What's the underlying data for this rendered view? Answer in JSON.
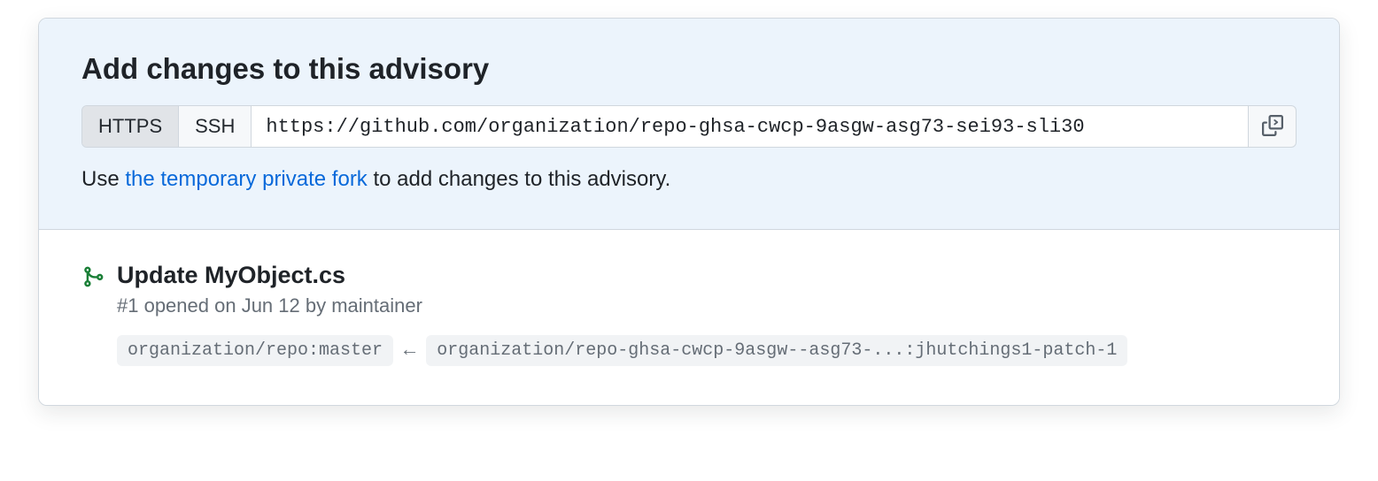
{
  "header": {
    "title": "Add changes to this advisory"
  },
  "clone": {
    "tab_https": "HTTPS",
    "tab_ssh": "SSH",
    "url": "https://github.com/organization/repo-ghsa-cwcp-9asgw-asg73-sei93-sli30"
  },
  "help": {
    "prefix": "Use ",
    "link": "the temporary private fork",
    "suffix": " to add changes to this advisory."
  },
  "pr": {
    "title": "Update MyObject.cs",
    "meta": "#1 opened on Jun 12 by maintainer",
    "base_branch": "organization/repo:master",
    "head_branch": "organization/repo-ghsa-cwcp-9asgw--asg73-...:jhutchings1-patch-1"
  }
}
